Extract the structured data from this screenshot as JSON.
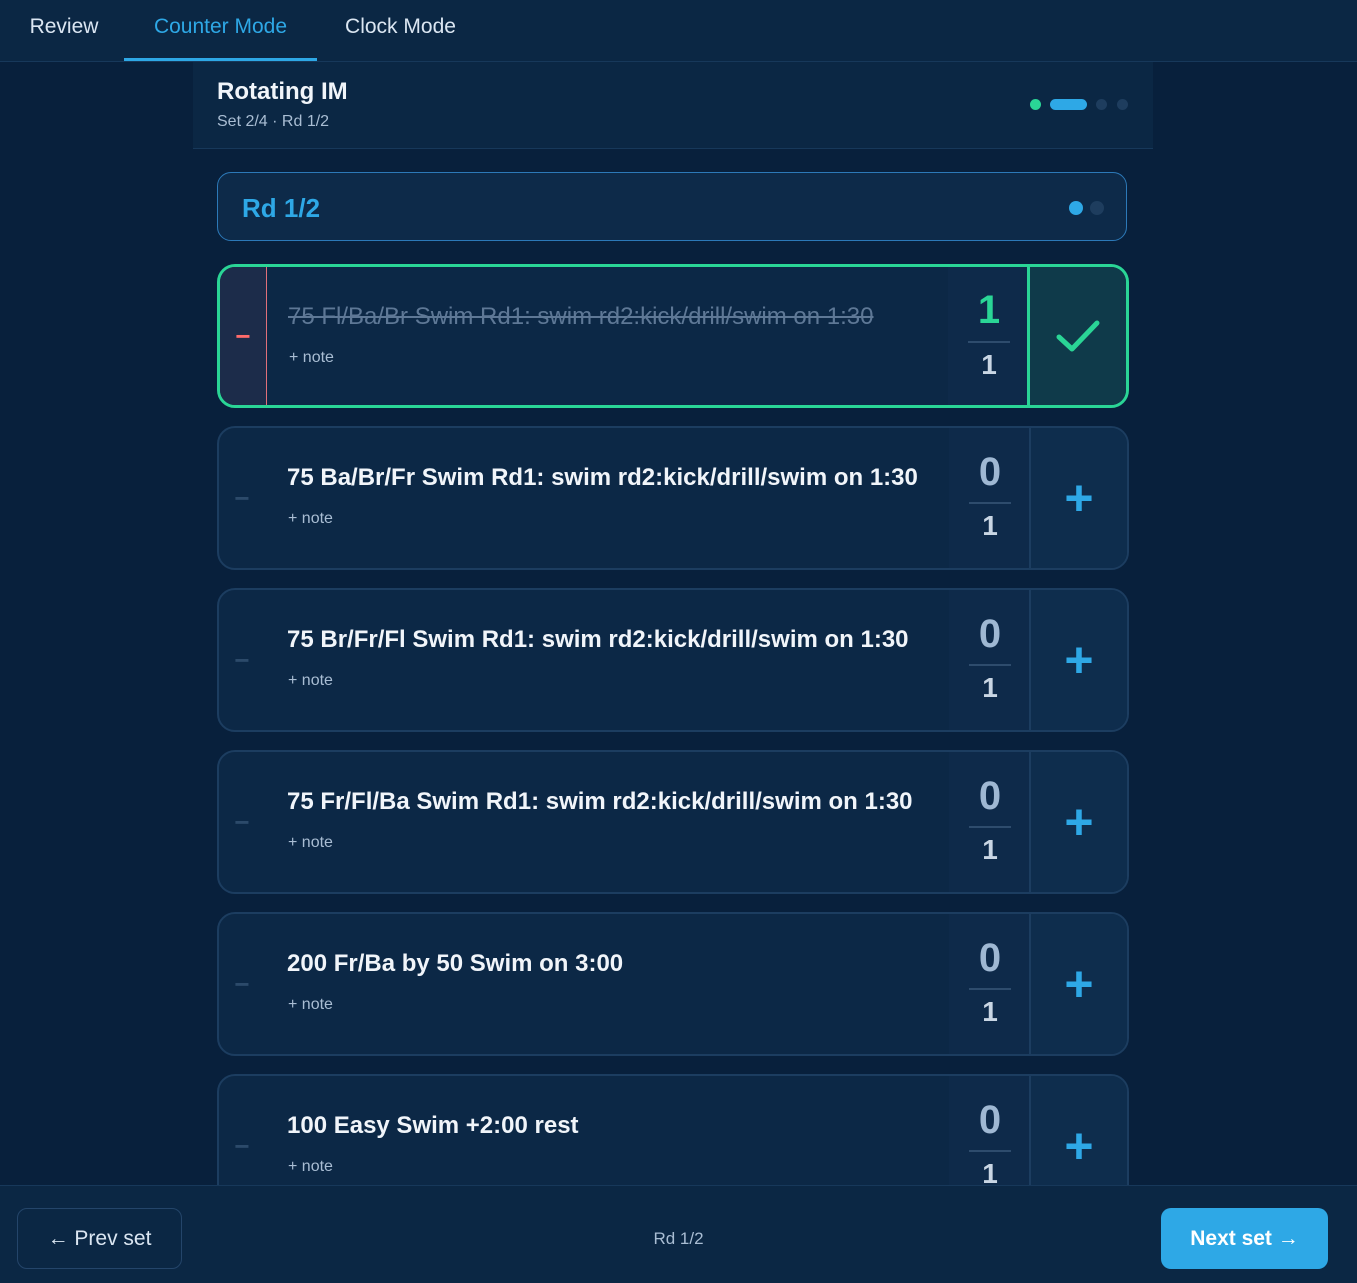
{
  "tabs": [
    {
      "label": "Review",
      "active": false
    },
    {
      "label": "Counter Mode",
      "active": true
    },
    {
      "label": "Clock Mode",
      "active": false
    }
  ],
  "set": {
    "title": "Rotating IM",
    "subtitle": "Set 2/4 · Rd 1/2",
    "progress": {
      "total_sets": 4,
      "current_set": 2
    }
  },
  "round": {
    "label": "Rd 1/2",
    "current": 1,
    "total": 2
  },
  "items": [
    {
      "description": "75 Fl/Ba/Br Swim Rd1: swim rd2:kick/drill/swim on 1:30",
      "note_label": "+ note",
      "done_count": "1",
      "total_count": "1",
      "completed": true
    },
    {
      "description": "75 Ba/Br/Fr Swim Rd1: swim rd2:kick/drill/swim on 1:30",
      "note_label": "+ note",
      "done_count": "0",
      "total_count": "1",
      "completed": false
    },
    {
      "description": "75 Br/Fr/Fl Swim Rd1: swim rd2:kick/drill/swim on 1:30",
      "note_label": "+ note",
      "done_count": "0",
      "total_count": "1",
      "completed": false
    },
    {
      "description": "75 Fr/Fl/Ba Swim Rd1: swim rd2:kick/drill/swim on 1:30",
      "note_label": "+ note",
      "done_count": "0",
      "total_count": "1",
      "completed": false
    },
    {
      "description": "200 Fr/Ba by 50 Swim on 3:00",
      "note_label": "+ note",
      "done_count": "0",
      "total_count": "1",
      "completed": false
    },
    {
      "description": "100 Easy Swim +2:00 rest",
      "note_label": "+ note",
      "done_count": "0",
      "total_count": "1",
      "completed": false
    }
  ],
  "footer": {
    "prev_label": "← Prev set",
    "round_label": "Rd 1/2",
    "next_label": "Next set →"
  },
  "colors": {
    "accent": "#2ea8e6",
    "success": "#2ad596",
    "danger": "#ff6b6b",
    "background": "#08203c"
  }
}
